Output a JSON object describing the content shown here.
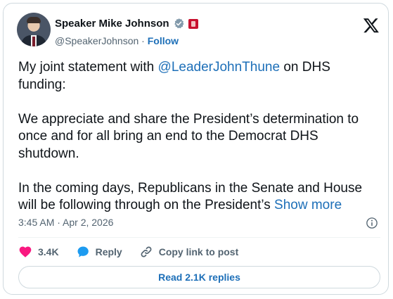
{
  "author": {
    "display_name": "Speaker Mike Johnson",
    "handle": "@SpeakerJohnson",
    "separator": " · ",
    "follow_label": "Follow"
  },
  "post": {
    "p1_prefix": "My joint statement with ",
    "p1_mention": "@LeaderJohnThune",
    "p1_suffix": " on DHS funding:",
    "p2": "We appreciate and share the President’s determination to once and for all bring an end to the Democrat DHS shutdown.",
    "p3": "In the coming days, Republicans in the Senate and House will be following through on the President’s ",
    "show_more": "Show more",
    "timestamp": "3:45 AM · Apr 2, 2026"
  },
  "actions": {
    "likes": "3.4K",
    "reply_label": "Reply",
    "copy_label": "Copy link to post"
  },
  "replies_button": "Read 2.1K replies",
  "colors": {
    "link": "#1d6fb8",
    "like": "#f91880",
    "reply": "#1d9bf0",
    "verified": "#829aab",
    "gov_badge": "#c8102e"
  },
  "icons": [
    "verified-badge-icon",
    "government-badge-icon",
    "x-logo-icon",
    "info-icon",
    "heart-icon",
    "reply-bubble-icon",
    "link-icon"
  ]
}
